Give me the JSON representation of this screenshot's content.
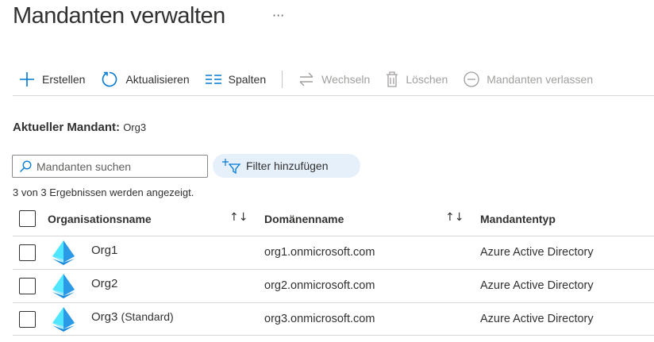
{
  "page": {
    "title": "Mandanten verwalten",
    "more": "···"
  },
  "toolbar": {
    "create": "Erstellen",
    "refresh": "Aktualisieren",
    "columns": "Spalten",
    "switch": "Wechseln",
    "delete": "Löschen",
    "leave": "Mandanten verlassen"
  },
  "current": {
    "label": "Aktueller Mandant:",
    "value": "Org3"
  },
  "search": {
    "placeholder": "Mandanten suchen"
  },
  "filter": {
    "label": "Filter hinzufügen"
  },
  "results": "3 von 3 Ergebnissen werden angezeigt.",
  "table": {
    "headers": [
      "Organisationsname",
      "Domänenname",
      "Mandantentyp"
    ],
    "sort_icon": "↑↓",
    "rows": [
      {
        "name": "Org1",
        "suffix": "",
        "domain": "org1.onmicrosoft.com",
        "type": "Azure Active Directory"
      },
      {
        "name": "Org2",
        "suffix": "",
        "domain": "org2.onmicrosoft.com",
        "type": "Azure Active Directory"
      },
      {
        "name": "Org3",
        "suffix": "(Standard)",
        "domain": "org3.onmicrosoft.com",
        "type": "Azure Active Directory"
      }
    ]
  },
  "colors": {
    "accent": "#0078d4",
    "filter_bg": "#e6f0fb"
  }
}
